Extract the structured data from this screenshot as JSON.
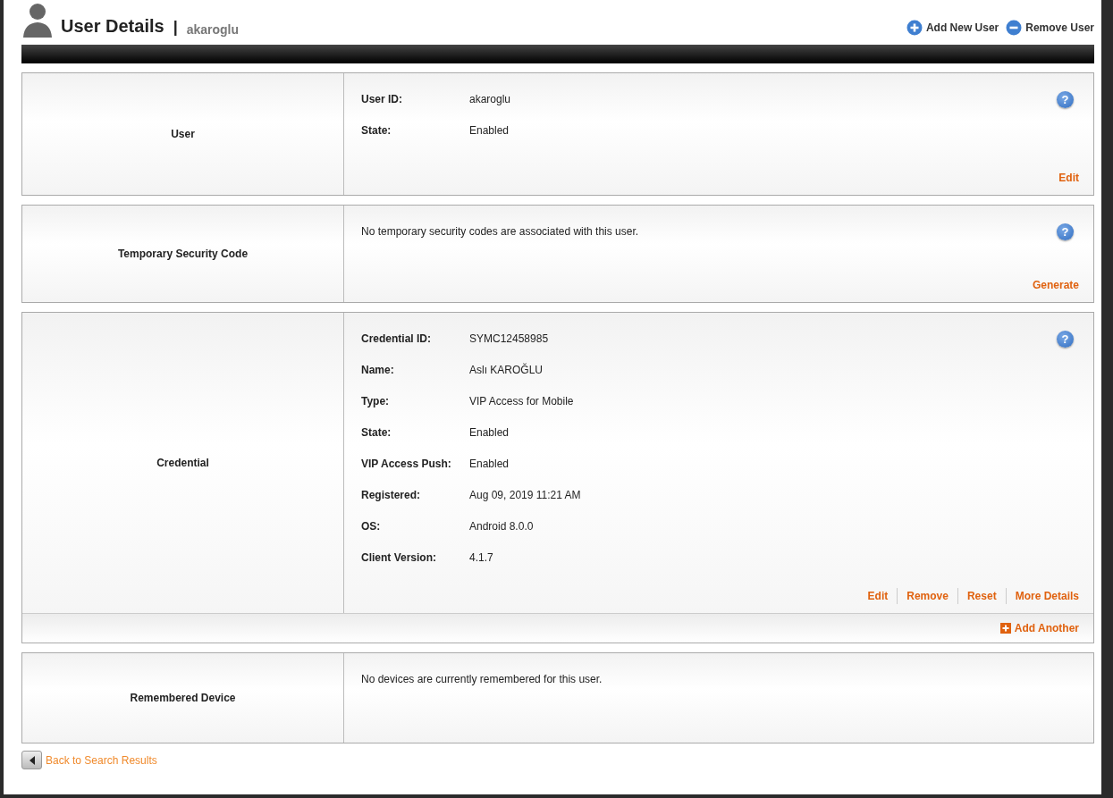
{
  "header": {
    "title": "User Details",
    "separator": "|",
    "username": "akaroglu",
    "actions": [
      {
        "label": "Add New User",
        "kind": "add"
      },
      {
        "label": "Remove User",
        "kind": "remove"
      }
    ]
  },
  "sections": [
    {
      "label": "User",
      "help": "?",
      "fields": [
        {
          "label": "User ID:",
          "value": "akaroglu"
        },
        {
          "label": "State:",
          "value": "Enabled"
        }
      ],
      "links": [
        "Edit"
      ]
    },
    {
      "label": "Temporary Security Code",
      "help": "?",
      "message": "No temporary security codes are associated with this user.",
      "links": [
        "Generate"
      ]
    },
    {
      "label": "Credential",
      "help": "?",
      "fields": [
        {
          "label": "Credential ID:",
          "value": "SYMC12458985"
        },
        {
          "label": "Name:",
          "value": "Aslı KAROĞLU"
        },
        {
          "label": "Type:",
          "value": "VIP Access for Mobile"
        },
        {
          "label": "State:",
          "value": "Enabled"
        },
        {
          "label": "VIP Access Push:",
          "value": "Enabled"
        },
        {
          "label": "Registered:",
          "value": "Aug 09, 2019 11:21 AM"
        },
        {
          "label": "OS:",
          "value": "Android 8.0.0"
        },
        {
          "label": "Client Version:",
          "value": "4.1.7"
        }
      ],
      "links": [
        "Edit",
        "Remove",
        "Reset",
        "More Details"
      ],
      "footer_link": "Add Another"
    },
    {
      "label": "Remembered Device",
      "message": "No devices are currently remembered for this user."
    }
  ],
  "back_link": "Back to Search Results"
}
